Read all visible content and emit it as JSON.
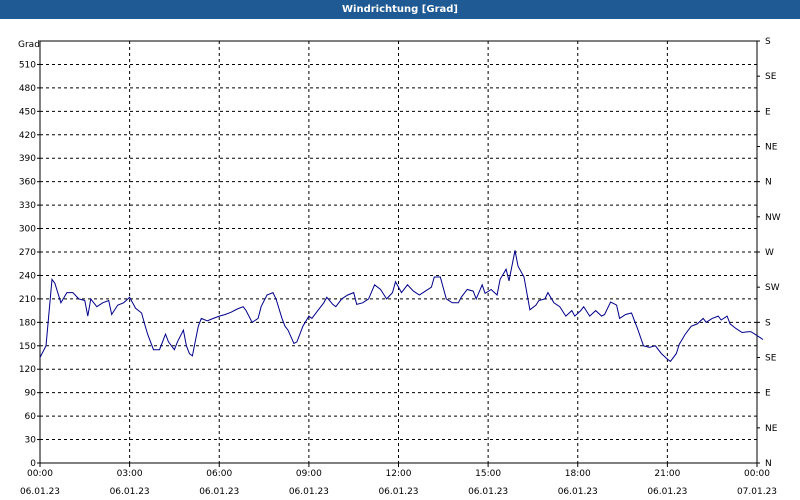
{
  "window": {
    "title": "Windrichtung [Grad]"
  },
  "chart_data": {
    "type": "line",
    "title": "Windrichtung [Grad]",
    "ylabel": "Grad",
    "ylim": [
      0,
      540
    ],
    "yticks": [
      0,
      30,
      60,
      90,
      120,
      150,
      180,
      210,
      240,
      270,
      300,
      330,
      360,
      390,
      420,
      450,
      480,
      510
    ],
    "right_axis_labels": [
      "N",
      "NE",
      "E",
      "SE",
      "S",
      "SW",
      "W",
      "NW",
      "N",
      "NE",
      "E",
      "SE",
      "S"
    ],
    "right_axis_values": [
      0,
      45,
      90,
      135,
      180,
      225,
      270,
      315,
      360,
      405,
      450,
      495,
      540
    ],
    "xlim": [
      0,
      24
    ],
    "xticks": [
      {
        "x": 0,
        "time": "00:00",
        "date": "06.01.23"
      },
      {
        "x": 3,
        "time": "03:00",
        "date": "06.01.23"
      },
      {
        "x": 6,
        "time": "06:00",
        "date": "06.01.23"
      },
      {
        "x": 9,
        "time": "09:00",
        "date": "06.01.23"
      },
      {
        "x": 12,
        "time": "12:00",
        "date": "06.01.23"
      },
      {
        "x": 15,
        "time": "15:00",
        "date": "06.01.23"
      },
      {
        "x": 18,
        "time": "18:00",
        "date": "06.01.23"
      },
      {
        "x": 21,
        "time": "21:00",
        "date": "06.01.23"
      },
      {
        "x": 24,
        "time": "00:00",
        "date": "07.01.23"
      }
    ],
    "grid": true,
    "line_color": "#00008b",
    "series": [
      {
        "values": [
          [
            0.0,
            135
          ],
          [
            0.2,
            150
          ],
          [
            0.4,
            235
          ],
          [
            0.5,
            230
          ],
          [
            0.7,
            205
          ],
          [
            0.9,
            218
          ],
          [
            1.1,
            218
          ],
          [
            1.3,
            210
          ],
          [
            1.5,
            208
          ],
          [
            1.6,
            188
          ],
          [
            1.7,
            210
          ],
          [
            1.9,
            200
          ],
          [
            2.1,
            205
          ],
          [
            2.3,
            208
          ],
          [
            2.4,
            190
          ],
          [
            2.6,
            202
          ],
          [
            2.8,
            205
          ],
          [
            3.0,
            212
          ],
          [
            3.2,
            198
          ],
          [
            3.4,
            192
          ],
          [
            3.5,
            178
          ],
          [
            3.6,
            165
          ],
          [
            3.8,
            145
          ],
          [
            4.0,
            145
          ],
          [
            4.2,
            165
          ],
          [
            4.3,
            155
          ],
          [
            4.5,
            145
          ],
          [
            4.6,
            155
          ],
          [
            4.8,
            170
          ],
          [
            4.9,
            150
          ],
          [
            5.0,
            140
          ],
          [
            5.1,
            137
          ],
          [
            5.3,
            175
          ],
          [
            5.4,
            185
          ],
          [
            5.6,
            182
          ],
          [
            5.8,
            185
          ],
          [
            6.0,
            188
          ],
          [
            6.2,
            190
          ],
          [
            6.4,
            193
          ],
          [
            6.6,
            197
          ],
          [
            6.8,
            200
          ],
          [
            6.9,
            195
          ],
          [
            7.1,
            180
          ],
          [
            7.3,
            185
          ],
          [
            7.4,
            200
          ],
          [
            7.6,
            215
          ],
          [
            7.8,
            218
          ],
          [
            7.9,
            210
          ],
          [
            8.1,
            185
          ],
          [
            8.2,
            175
          ],
          [
            8.3,
            170
          ],
          [
            8.5,
            153
          ],
          [
            8.6,
            155
          ],
          [
            8.8,
            175
          ],
          [
            9.0,
            188
          ],
          [
            9.1,
            185
          ],
          [
            9.3,
            195
          ],
          [
            9.5,
            205
          ],
          [
            9.6,
            212
          ],
          [
            9.8,
            203
          ],
          [
            9.9,
            200
          ],
          [
            10.1,
            210
          ],
          [
            10.3,
            215
          ],
          [
            10.5,
            218
          ],
          [
            10.6,
            203
          ],
          [
            10.8,
            205
          ],
          [
            11.0,
            210
          ],
          [
            11.2,
            228
          ],
          [
            11.4,
            222
          ],
          [
            11.6,
            210
          ],
          [
            11.8,
            218
          ],
          [
            11.9,
            232
          ],
          [
            12.1,
            218
          ],
          [
            12.3,
            228
          ],
          [
            12.5,
            220
          ],
          [
            12.7,
            215
          ],
          [
            12.9,
            220
          ],
          [
            13.1,
            225
          ],
          [
            13.2,
            238
          ],
          [
            13.4,
            238
          ],
          [
            13.6,
            210
          ],
          [
            13.8,
            205
          ],
          [
            14.0,
            205
          ],
          [
            14.1,
            212
          ],
          [
            14.3,
            222
          ],
          [
            14.5,
            220
          ],
          [
            14.6,
            210
          ],
          [
            14.8,
            228
          ],
          [
            14.9,
            217
          ],
          [
            15.1,
            222
          ],
          [
            15.3,
            215
          ],
          [
            15.4,
            235
          ],
          [
            15.6,
            248
          ],
          [
            15.7,
            233
          ],
          [
            15.9,
            272
          ],
          [
            16.0,
            252
          ],
          [
            16.2,
            238
          ],
          [
            16.4,
            196
          ],
          [
            16.6,
            202
          ],
          [
            16.7,
            208
          ],
          [
            16.9,
            210
          ],
          [
            17.0,
            218
          ],
          [
            17.2,
            205
          ],
          [
            17.4,
            200
          ],
          [
            17.6,
            188
          ],
          [
            17.8,
            195
          ],
          [
            17.9,
            188
          ],
          [
            18.1,
            195
          ],
          [
            18.2,
            200
          ],
          [
            18.4,
            188
          ],
          [
            18.6,
            195
          ],
          [
            18.8,
            188
          ],
          [
            18.9,
            190
          ],
          [
            19.1,
            206
          ],
          [
            19.3,
            202
          ],
          [
            19.4,
            185
          ],
          [
            19.6,
            190
          ],
          [
            19.8,
            192
          ],
          [
            20.0,
            172
          ],
          [
            20.2,
            150
          ],
          [
            20.4,
            148
          ],
          [
            20.6,
            150
          ],
          [
            20.8,
            140
          ],
          [
            21.0,
            133
          ],
          [
            21.1,
            130
          ],
          [
            21.3,
            140
          ],
          [
            21.4,
            152
          ],
          [
            21.6,
            165
          ],
          [
            21.8,
            175
          ],
          [
            22.0,
            178
          ],
          [
            22.2,
            185
          ],
          [
            22.3,
            180
          ],
          [
            22.5,
            185
          ],
          [
            22.7,
            188
          ],
          [
            22.8,
            183
          ],
          [
            23.0,
            188
          ],
          [
            23.1,
            178
          ],
          [
            23.3,
            172
          ],
          [
            23.5,
            167
          ],
          [
            23.7,
            168
          ],
          [
            23.8,
            168
          ],
          [
            24.0,
            163
          ],
          [
            24.2,
            158
          ]
        ]
      }
    ]
  }
}
